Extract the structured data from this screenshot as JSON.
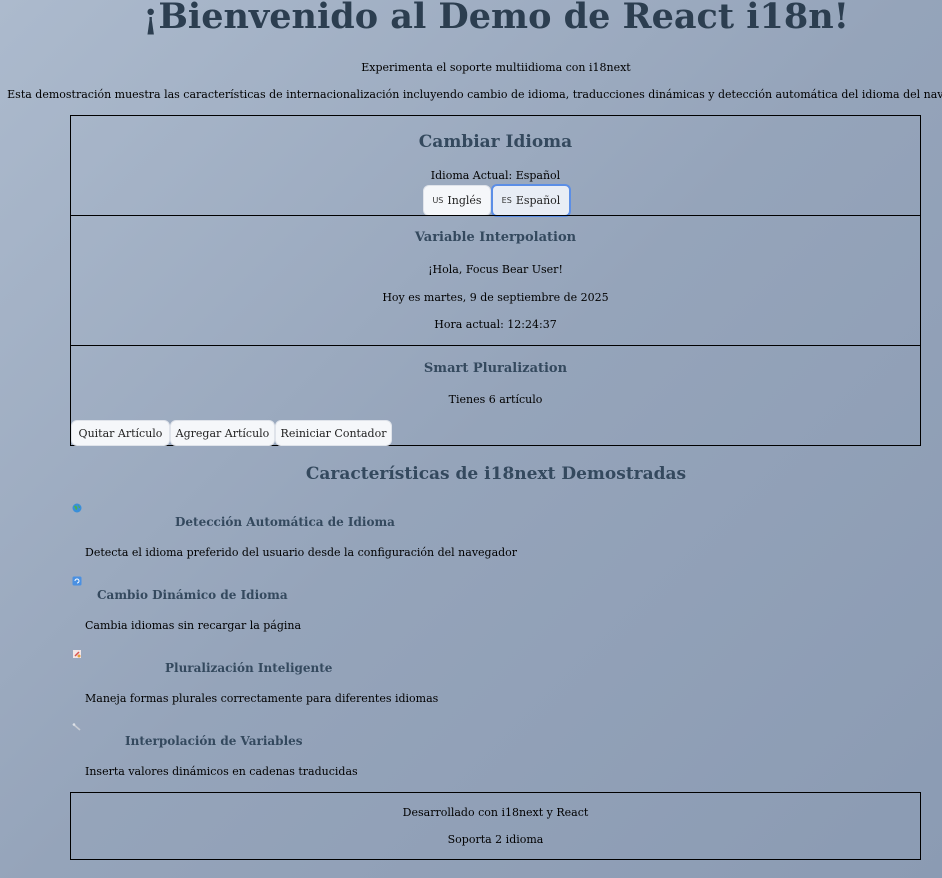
{
  "header": {
    "title": "¡Bienvenido al Demo de React i18n!",
    "subtitle": "Experimenta el soporte multiidioma con i18next",
    "description": "Esta demostración muestra las características de internacionalización incluyendo cambio de idioma, traducciones dinámicas y detección automática del idioma del navegador."
  },
  "language": {
    "title": "Cambiar Idioma",
    "current": "Idioma Actual: Español",
    "buttons": [
      {
        "flag": "US",
        "label": "Inglés",
        "active": false
      },
      {
        "flag": "ES",
        "label": "Español",
        "active": true
      }
    ]
  },
  "interpolation": {
    "title": "Variable Interpolation",
    "greeting": "¡Hola, Focus Bear User!",
    "date": "Hoy es martes, 9 de septiembre de 2025",
    "time": "Hora actual: 12:24:37"
  },
  "plural": {
    "title": "Smart Pluralization",
    "count_text": "Tienes 6 artículo",
    "remove_label": "Quitar Artículo",
    "add_label": "Agregar Artículo",
    "reset_label": "Reiniciar Contador"
  },
  "features": {
    "title": "Características de i18next Demostradas",
    "items": [
      {
        "icon": "globe-icon",
        "title": "Detección Automática de Idioma",
        "desc": "Detecta el idioma preferido del usuario desde la configuración del navegador"
      },
      {
        "icon": "refresh-icon",
        "title": "Cambio Dinámico de Idioma",
        "desc": "Cambia idiomas sin recargar la página"
      },
      {
        "icon": "numbers-icon",
        "title": "Pluralización Inteligente",
        "desc": "Maneja formas plurales correctamente para diferentes idiomas"
      },
      {
        "icon": "wrench-icon",
        "title": "Interpolación de Variables",
        "desc": "Inserta valores dinámicos en cadenas traducidas"
      }
    ]
  },
  "footer": {
    "built_with": "Desarrollado con i18next y React",
    "supports": "Soporta 2 idioma"
  }
}
